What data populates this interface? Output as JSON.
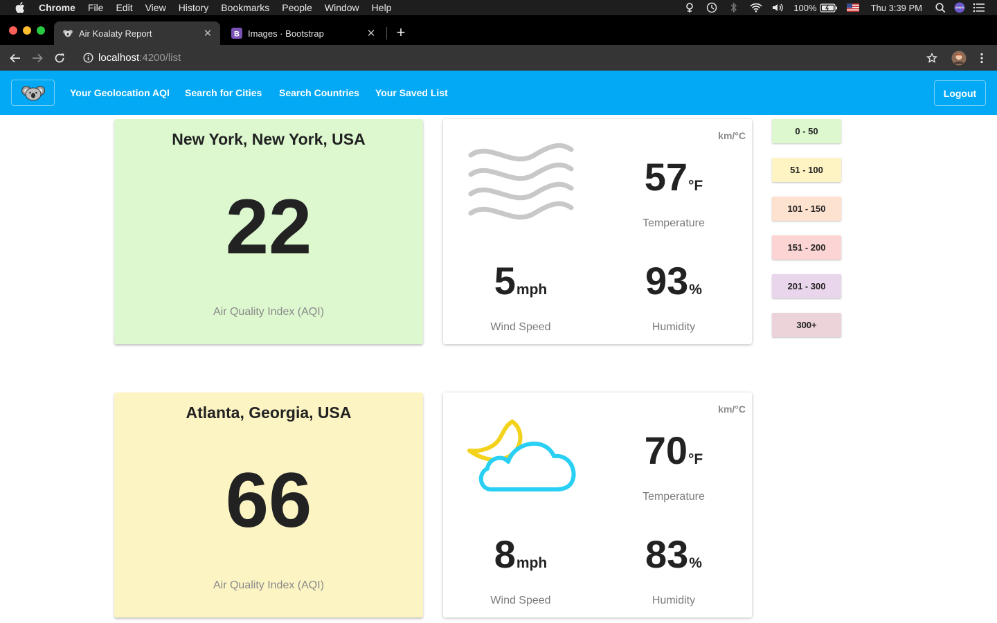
{
  "menubar": {
    "app": "Chrome",
    "items": [
      "File",
      "Edit",
      "View",
      "History",
      "Bookmarks",
      "People",
      "Window",
      "Help"
    ],
    "battery": "100%",
    "clock": "Thu 3:39 PM"
  },
  "tabs": [
    {
      "title": "Air Koalaty Report",
      "favicon": "koala-icon",
      "active": true
    },
    {
      "title": "Images · Bootstrap",
      "favicon": "bootstrap-icon",
      "active": false
    }
  ],
  "omnibox": {
    "host": "localhost",
    "path": ":4200/list"
  },
  "nav": {
    "links": [
      "Your Geolocation AQI",
      "Search for Cities",
      "Search Countries",
      "Your Saved List"
    ],
    "logout": "Logout"
  },
  "cities": [
    {
      "name": "New York, New York, USA",
      "aqi": "22",
      "aqi_label": "Air Quality Index (AQI)",
      "aqi_color": "#ddf8cf",
      "units_toggle": "km/°C",
      "weather_icon": "wind-icon",
      "temperature": "57",
      "temperature_unit": "°F",
      "temperature_label": "Temperature",
      "wind": "5",
      "wind_unit": "mph",
      "wind_label": "Wind Speed",
      "humidity": "93",
      "humidity_unit": "%",
      "humidity_label": "Humidity"
    },
    {
      "name": "Atlanta, Georgia, USA",
      "aqi": "66",
      "aqi_label": "Air Quality Index (AQI)",
      "aqi_color": "#fdf4c4",
      "units_toggle": "km/°C",
      "weather_icon": "moon-cloud-icon",
      "temperature": "70",
      "temperature_unit": "°F",
      "temperature_label": "Temperature",
      "wind": "8",
      "wind_unit": "mph",
      "wind_label": "Wind Speed",
      "humidity": "83",
      "humidity_unit": "%",
      "humidity_label": "Humidity"
    }
  ],
  "legend": [
    {
      "label": "0 - 50",
      "color": "#ddf8cf"
    },
    {
      "label": "51 - 100",
      "color": "#fdf3c3"
    },
    {
      "label": "101 - 150",
      "color": "#fde2cf"
    },
    {
      "label": "151 - 200",
      "color": "#fdd4d4"
    },
    {
      "label": "201 - 300",
      "color": "#ead6ec"
    },
    {
      "label": "300+",
      "color": "#ebd3d9"
    }
  ]
}
